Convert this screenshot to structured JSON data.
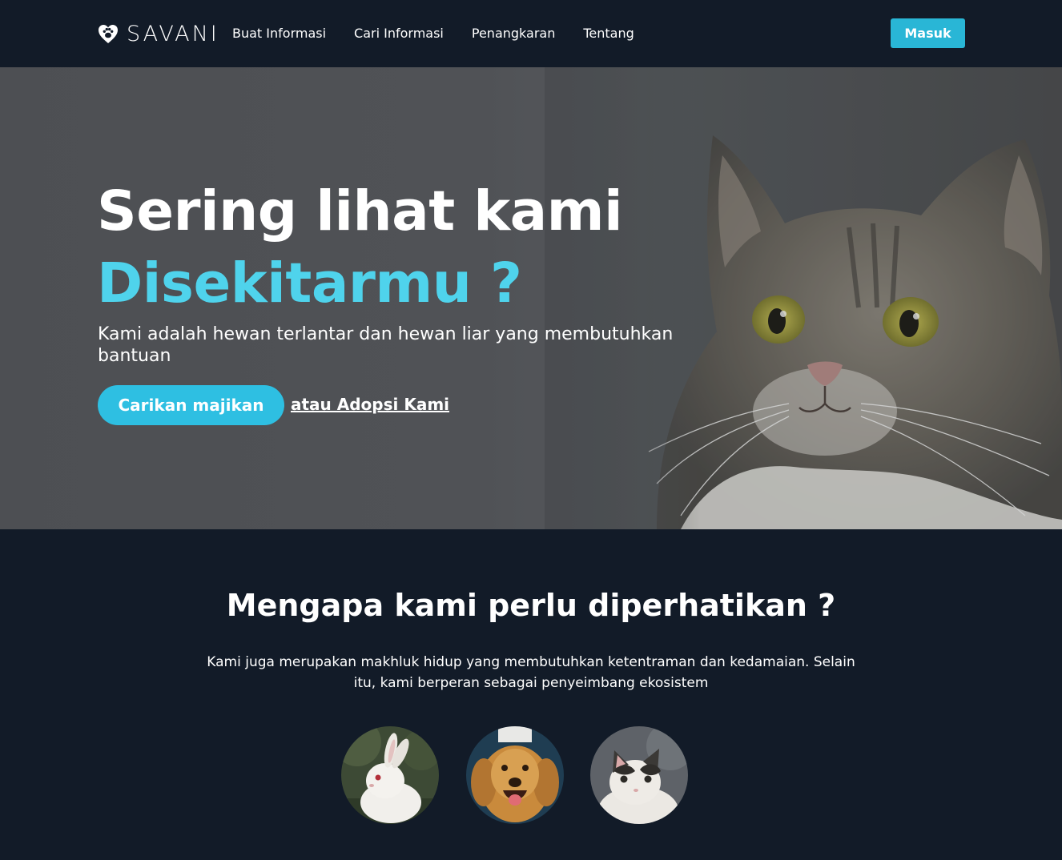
{
  "brand": {
    "name": "SAVANI",
    "icon": "paw-heart-icon"
  },
  "nav": {
    "links": [
      "Buat Informasi",
      "Cari Informasi",
      "Penangkaran",
      "Tentang"
    ],
    "login_label": "Masuk"
  },
  "hero": {
    "title": "Sering lihat kami",
    "accent": "Disekitarmu ?",
    "description": "Kami adalah hewan terlantar dan hewan liar yang membutuhkan bantuan",
    "cta_label": "Carikan majikan",
    "secondary_link": "atau Adopsi Kami",
    "image": "cat-photo"
  },
  "section": {
    "title": "Mengapa kami perlu diperhatikan ?",
    "description": "Kami juga merupakan makhluk hidup yang membutuhkan ketentraman dan kedamaian. Selain itu, kami berperan sebagai penyeimbang ekosistem"
  },
  "animals": [
    {
      "image": "rabbit-photo"
    },
    {
      "image": "dog-photo"
    },
    {
      "image": "kitten-photo"
    }
  ],
  "colors": {
    "background": "#121b28",
    "accent": "#4fd3ec",
    "button": "#29b6d6",
    "hero_overlay": "#505256"
  }
}
